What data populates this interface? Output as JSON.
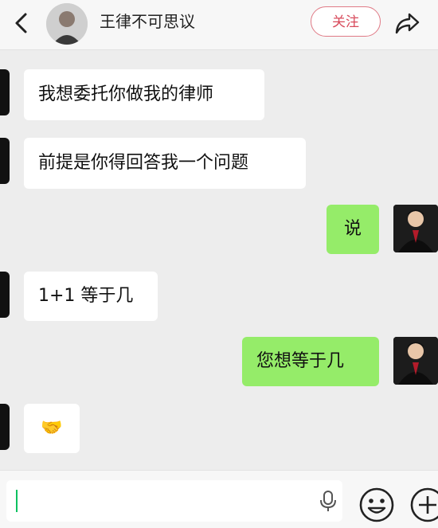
{
  "header": {
    "title": "王律不可思议",
    "follow_label": "关注"
  },
  "messages": [
    {
      "side": "in",
      "text": "我想委托你做我的律师"
    },
    {
      "side": "in",
      "text": "前提是你得回答我一个问题"
    },
    {
      "side": "out",
      "text": "说"
    },
    {
      "side": "in",
      "text": "1+1 等于几"
    },
    {
      "side": "out",
      "text": "您想等于几"
    },
    {
      "side": "in",
      "text": "🤝"
    }
  ],
  "icons": {
    "back": "back-arrow-icon",
    "share": "share-arrow-icon",
    "mic": "microphone-icon",
    "emoji": "emoji-icon",
    "plus": "plus-icon"
  },
  "colors": {
    "outgoing_bubble": "#95ec69",
    "incoming_bubble": "#ffffff",
    "follow_accent": "#d84b5c",
    "caret": "#07c160"
  }
}
